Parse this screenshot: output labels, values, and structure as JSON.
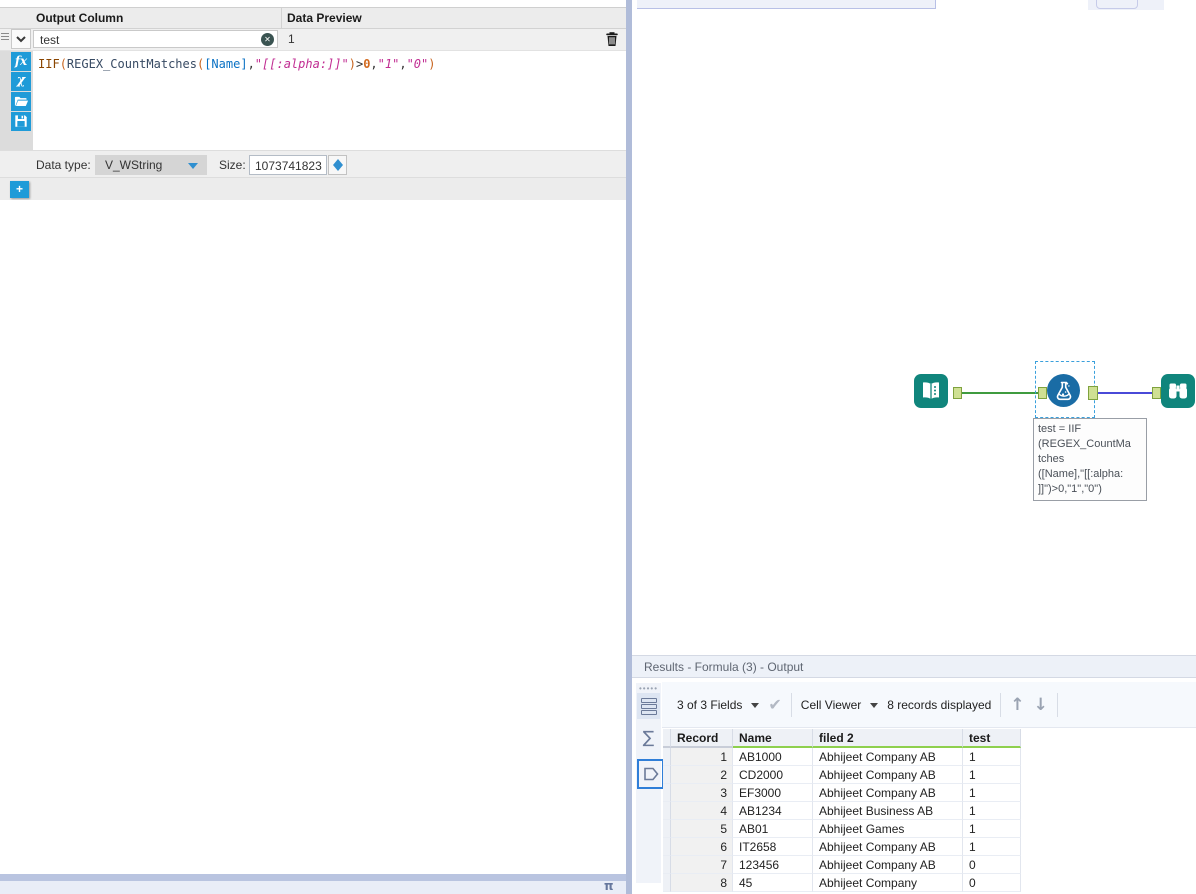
{
  "colors": {
    "accent_blue": "#1f9bd8",
    "tool_teal": "#10857c",
    "formula_tool_blue": "#1a6ca5",
    "header_green_underline": "#8ed04e",
    "connection_green": "#3f9b3f",
    "connection_blue": "#4a4ad8"
  },
  "left_panel": {
    "columns_header": {
      "output_column": "Output Column",
      "data_preview": "Data Preview"
    },
    "field_row": {
      "name_value": "test",
      "preview_value": "1"
    },
    "editor_icons": [
      {
        "name": "insert-function-icon",
        "glyph": "fx"
      },
      {
        "name": "insert-variable-icon",
        "glyph": "χ"
      },
      {
        "name": "open-expression-icon"
      },
      {
        "name": "save-expression-icon"
      }
    ],
    "formula_segments": [
      {
        "t": "IIF",
        "c": "fn1"
      },
      {
        "t": "(",
        "c": "paren"
      },
      {
        "t": "REGEX_CountMatches",
        "c": "fn2"
      },
      {
        "t": "(",
        "c": "paren"
      },
      {
        "t": "[Name]",
        "c": "field"
      },
      {
        "t": ",",
        "c": "op"
      },
      {
        "t": "\"[[:alpha:]]\"",
        "c": "str"
      },
      {
        "t": ")",
        "c": "paren"
      },
      {
        "t": ">",
        "c": "op"
      },
      {
        "t": "0",
        "c": "num"
      },
      {
        "t": ",",
        "c": "op"
      },
      {
        "t": "\"1\"",
        "c": "str"
      },
      {
        "t": ",",
        "c": "op"
      },
      {
        "t": "\"0\"",
        "c": "str"
      },
      {
        "t": ")",
        "c": "paren"
      }
    ],
    "data_type_row": {
      "label": "Data type:",
      "value": "V_WString",
      "size_label": "Size:",
      "size_value": "1073741823"
    },
    "add_button": "+",
    "bottom_glyph": "π"
  },
  "canvas": {
    "annotation_text": "test = IIF\n(REGEX_CountMa\ntches\n([Name],\"[[:alpha:\n]]\")>0,\"1\",\"0\")"
  },
  "results": {
    "title": "Results - Formula (3) - Output",
    "toolbar": {
      "fields_summary": "3 of 3 Fields",
      "check_glyph": "✔",
      "cell_viewer": "Cell Viewer",
      "records_displayed": "8 records displayed",
      "up_glyph": "↑",
      "down_glyph": "↓"
    },
    "side_icons": {
      "grip_glyph": "•••••",
      "sigma_glyph": "∑"
    },
    "table": {
      "columns": [
        {
          "label": "Record",
          "green": false
        },
        {
          "label": "Name",
          "green": true
        },
        {
          "label": "filed 2",
          "green": true
        },
        {
          "label": "test",
          "green": true
        }
      ],
      "rows": [
        [
          "1",
          "AB1000",
          "Abhijeet Company AB",
          "1"
        ],
        [
          "2",
          "CD2000",
          "Abhijeet Company AB",
          "1"
        ],
        [
          "3",
          "EF3000",
          "Abhijeet Company AB",
          "1"
        ],
        [
          "4",
          "AB1234",
          "Abhijeet Business AB",
          "1"
        ],
        [
          "5",
          "AB01",
          "Abhijeet Games",
          "1"
        ],
        [
          "6",
          "IT2658",
          "Abhijeet Company AB",
          "1"
        ],
        [
          "7",
          "123456",
          "Abhijeet Company AB",
          "0"
        ],
        [
          "8",
          "45",
          "Abhijeet Company",
          "0"
        ]
      ]
    }
  }
}
